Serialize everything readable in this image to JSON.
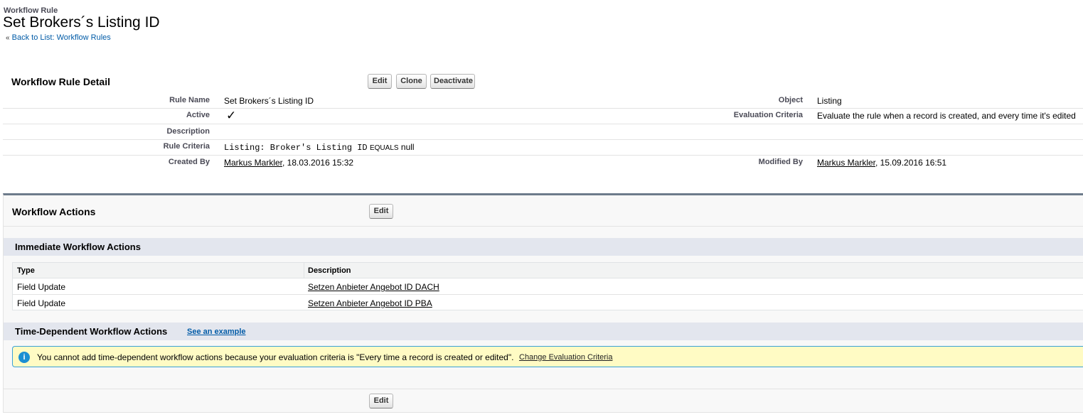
{
  "header": {
    "object_type": "Workflow Rule",
    "title": "Set Brokers´s Listing ID",
    "back_prefix": "«",
    "back_label": "Back to List: Workflow Rules"
  },
  "detail": {
    "title": "Workflow Rule Detail",
    "buttons": {
      "edit": "Edit",
      "clone": "Clone",
      "deactivate": "Deactivate"
    },
    "rule_name_label": "Rule Name",
    "rule_name": "Set Brokers´s Listing ID",
    "active_label": "Active",
    "active_checked": true,
    "check_glyph": "✓",
    "description_label": "Description",
    "description": "",
    "rule_criteria_label": "Rule Criteria",
    "rule_criteria_field": "Listing: Broker's Listing ID",
    "rule_criteria_operator": "EQUALS",
    "rule_criteria_value": "null",
    "created_by_label": "Created By",
    "created_by_name": "Markus Markler",
    "created_by_date": ", 18.03.2016 15:32",
    "object_label": "Object",
    "object": "Listing",
    "evaluation_label": "Evaluation Criteria",
    "evaluation": "Evaluate the rule when a record is created, and every time it's edited",
    "modified_by_label": "Modified By",
    "modified_by_name": "Markus Markler",
    "modified_by_date": ", 15.09.2016 16:51"
  },
  "actions": {
    "title": "Workflow Actions",
    "edit_label": "Edit",
    "immediate_title": "Immediate Workflow Actions",
    "columns": {
      "type": "Type",
      "description": "Description"
    },
    "rows": [
      {
        "type": "Field Update",
        "description": "Setzen Anbieter Angebot ID DACH"
      },
      {
        "type": "Field Update",
        "description": "Setzen Anbieter Angebot ID PBA"
      }
    ],
    "time_dependent_title": "Time-Dependent Workflow Actions",
    "see_example": "See an example",
    "info_icon": "info-icon",
    "info_text": "You cannot add time-dependent workflow actions because your evaluation criteria is \"Every time a record is created or edited\".",
    "change_criteria_link": "Change Evaluation Criteria",
    "bottom_edit_label": "Edit"
  },
  "colors": {
    "section_border": "#6d7b8b",
    "subsection_bg": "#e3e6ee",
    "info_bg": "#fffbc4",
    "info_border": "#39a1d7",
    "link": "#015ba7"
  }
}
